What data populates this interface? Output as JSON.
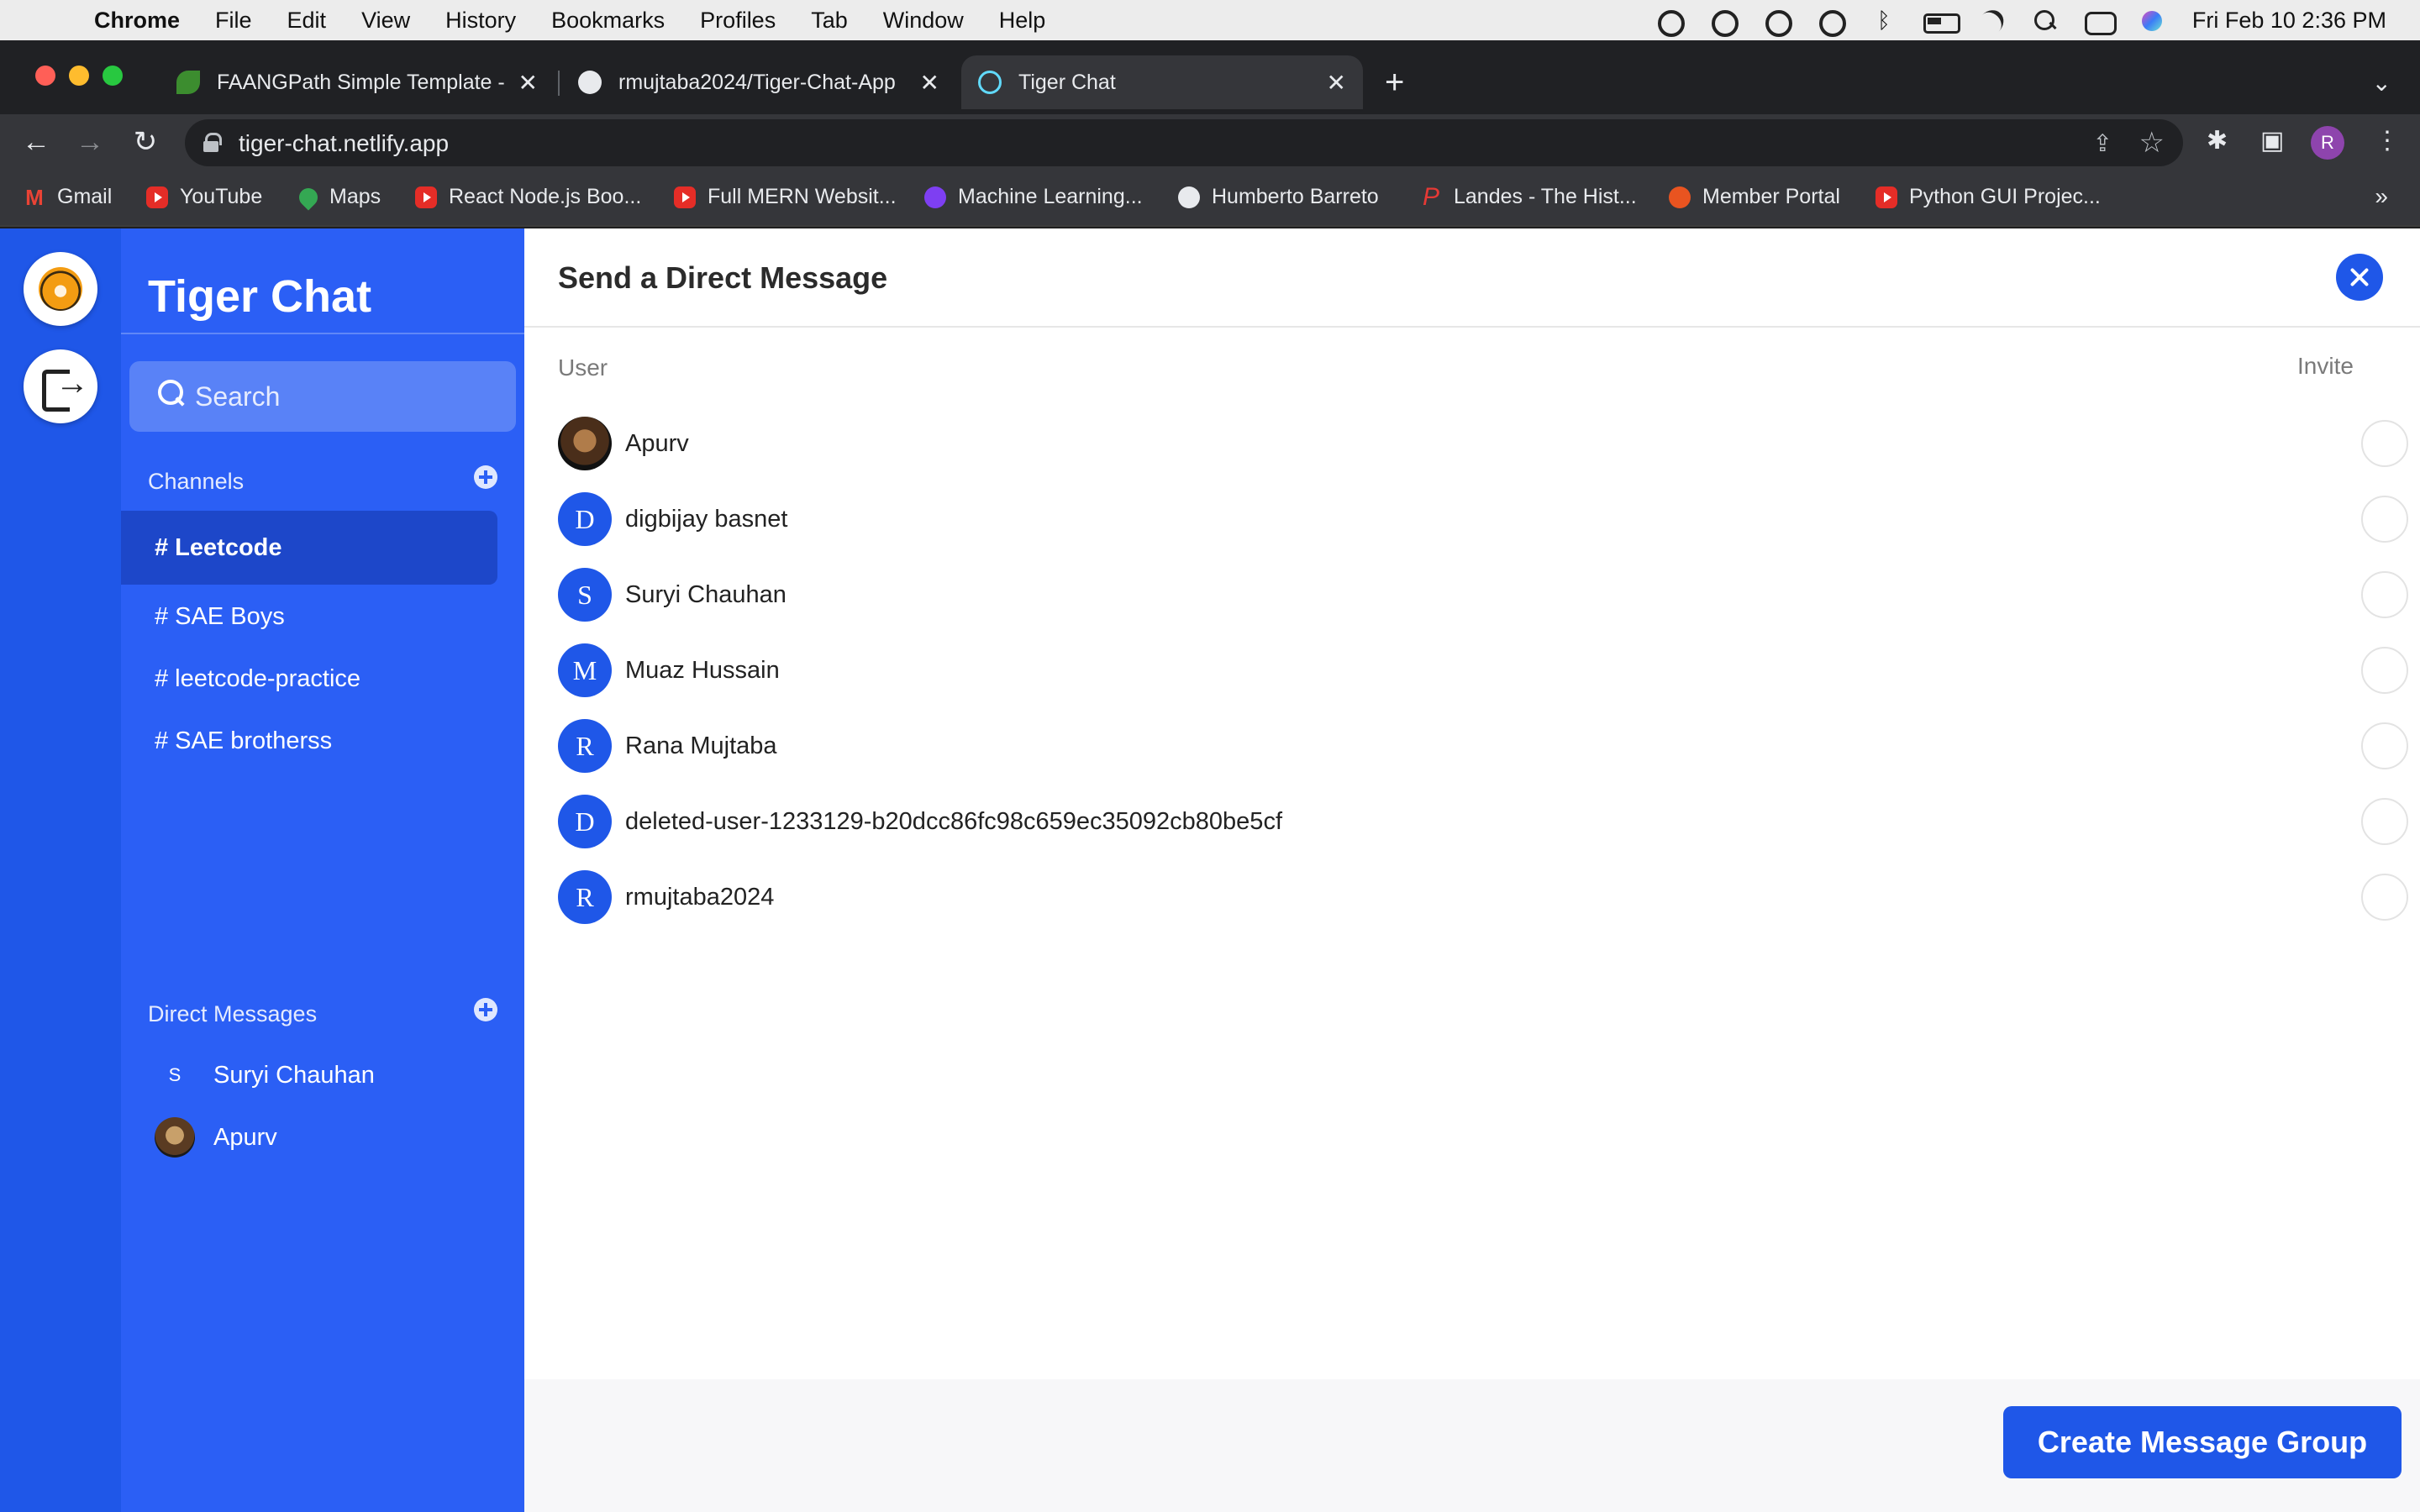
{
  "os_menubar": {
    "app_name": "Chrome",
    "menus": [
      "File",
      "Edit",
      "View",
      "History",
      "Bookmarks",
      "Profiles",
      "Tab",
      "Window",
      "Help"
    ],
    "clock": "Fri Feb 10  2:36 PM"
  },
  "browser": {
    "tabs": [
      {
        "title": "FAANGPath Simple Template -",
        "favicon": "leaf-icon",
        "active": false
      },
      {
        "title": "rmujtaba2024/Tiger-Chat-App",
        "favicon": "github-icon",
        "active": false
      },
      {
        "title": "Tiger Chat",
        "favicon": "react-icon",
        "active": true
      }
    ],
    "url": "tiger-chat.netlify.app",
    "profile_initial": "R",
    "bookmarks": [
      {
        "label": "Gmail",
        "icon": "gmail-icon"
      },
      {
        "label": "YouTube",
        "icon": "youtube-icon"
      },
      {
        "label": "Maps",
        "icon": "maps-icon"
      },
      {
        "label": "React Node.js Boo...",
        "icon": "youtube-icon"
      },
      {
        "label": "Full MERN Websit...",
        "icon": "youtube-icon"
      },
      {
        "label": "Machine Learning...",
        "icon": "ml-icon"
      },
      {
        "label": "Humberto Barreto",
        "icon": "globe-icon"
      },
      {
        "label": "Landes - The Hist...",
        "icon": "landes-icon"
      },
      {
        "label": "Member Portal",
        "icon": "member-icon"
      },
      {
        "label": "Python GUI Projec...",
        "icon": "youtube-icon"
      }
    ]
  },
  "sidebar": {
    "title": "Tiger Chat",
    "search_placeholder": "Search",
    "channels_heading": "Channels",
    "channels": [
      {
        "label": "# Leetcode",
        "active": true
      },
      {
        "label": "# SAE Boys",
        "active": false
      },
      {
        "label": "# leetcode-practice",
        "active": false
      },
      {
        "label": "# SAE brotherss",
        "active": false
      }
    ],
    "dm_heading": "Direct Messages",
    "direct_messages": [
      {
        "name": "Suryi Chauhan",
        "initial": "S",
        "photo": false
      },
      {
        "name": "Apurv",
        "initial": "",
        "photo": true
      }
    ]
  },
  "dialog": {
    "title": "Send a Direct Message",
    "col_user": "User",
    "col_invite": "Invite",
    "users": [
      {
        "name": "Apurv",
        "initial": "",
        "photo": true
      },
      {
        "name": "digbijay basnet",
        "initial": "D",
        "photo": false
      },
      {
        "name": "Suryi Chauhan",
        "initial": "S",
        "photo": false
      },
      {
        "name": "Muaz Hussain",
        "initial": "M",
        "photo": false
      },
      {
        "name": "Rana Mujtaba",
        "initial": "R",
        "photo": false
      },
      {
        "name": "deleted-user-1233129-b20dcc86fc98c659ec35092cb80be5cf",
        "initial": "D",
        "photo": false
      },
      {
        "name": "rmujtaba2024",
        "initial": "R",
        "photo": false
      }
    ],
    "create_button": "Create Message Group"
  },
  "colors": {
    "accent": "#1f57e8",
    "sidebar": "#2b5ff5",
    "active_channel": "#1d47c9"
  }
}
